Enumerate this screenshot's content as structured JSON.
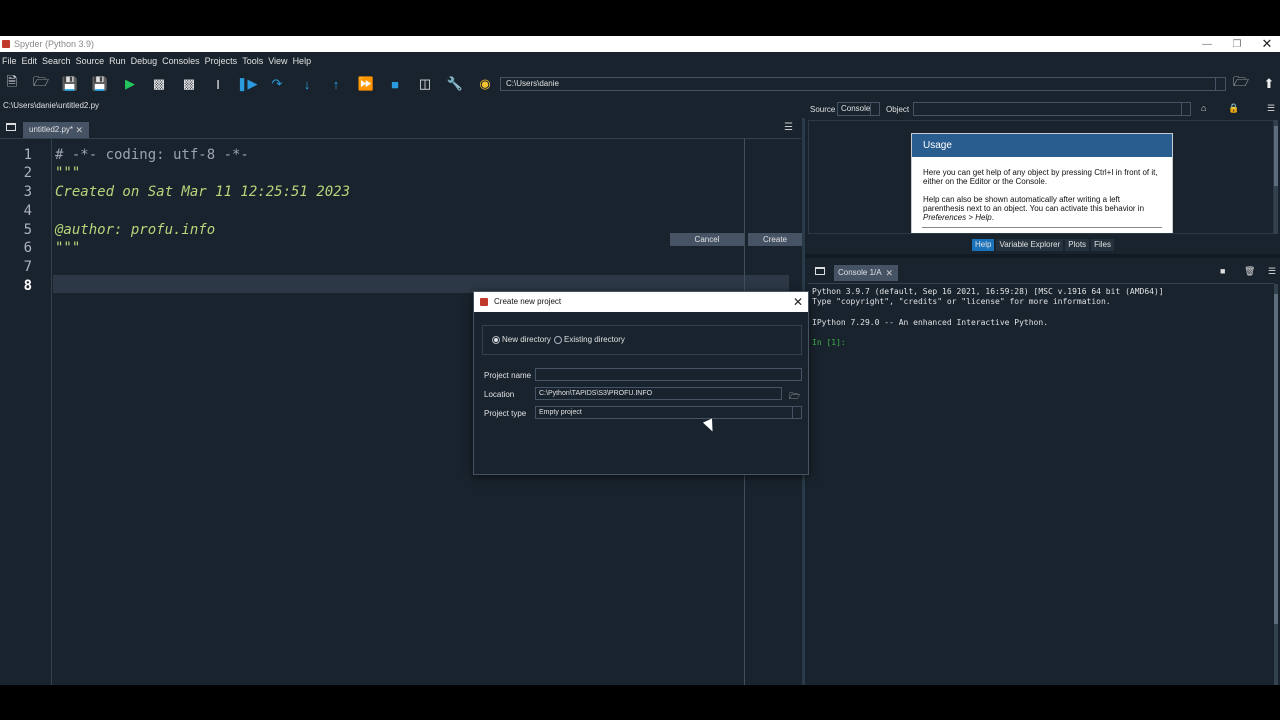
{
  "window": {
    "title": "Spyder (Python 3.9)"
  },
  "menu": [
    "File",
    "Edit",
    "Search",
    "Source",
    "Run",
    "Debug",
    "Consoles",
    "Projects",
    "Tools",
    "View",
    "Help"
  ],
  "toolbar": {
    "path": "C:\\Users\\danie"
  },
  "editor": {
    "file_path": "C:\\Users\\danie\\untitled2.py",
    "tab_label": "untitled2.py*",
    "lines": [
      {
        "n": "1",
        "text": "# -*- coding: utf-8 -*-"
      },
      {
        "n": "2",
        "text": "\"\"\""
      },
      {
        "n": "3",
        "text": "Created on Sat Mar 11 12:25:51 2023"
      },
      {
        "n": "4",
        "text": ""
      },
      {
        "n": "5",
        "text": "@author: profu.info"
      },
      {
        "n": "6",
        "text": "\"\"\""
      },
      {
        "n": "7",
        "text": ""
      },
      {
        "n": "8",
        "text": ""
      }
    ],
    "current_line": "8"
  },
  "help": {
    "source_label": "Source",
    "source_value": "Console",
    "object_label": "Object",
    "usage_title": "Usage",
    "p1": "Here you can get help of any object by pressing Ctrl+I in front of it, either on the Editor or the Console.",
    "p2a": "Help can also be shown automatically after writing a left parenthesis next to an object. You can activate this behavior in ",
    "p2b": "Preferences > Help",
    "p2c": ".",
    "tabs": [
      "Help",
      "Variable Explorer",
      "Plots",
      "Files"
    ]
  },
  "console": {
    "tab_label": "Console 1/A",
    "line1": "Python 3.9.7 (default, Sep 16 2021, 16:59:28) [MSC v.1916 64 bit (AMD64)]",
    "line2": "Type \"copyright\", \"credits\" or \"license\" for more information.",
    "line3": "IPython 7.29.0 -- An enhanced Interactive Python.",
    "prompt": "In [1]:"
  },
  "dialog": {
    "title": "Create new project",
    "radio_new": "New directory",
    "radio_existing": "Existing directory",
    "project_name_label": "Project name",
    "project_name_value": "",
    "location_label": "Location",
    "location_value": "C:\\Python\\TAPIDS\\S3\\PROFU.INFO",
    "project_type_label": "Project type",
    "project_type_value": "Empty project",
    "cancel_label": "Cancel",
    "create_label": "Create"
  }
}
